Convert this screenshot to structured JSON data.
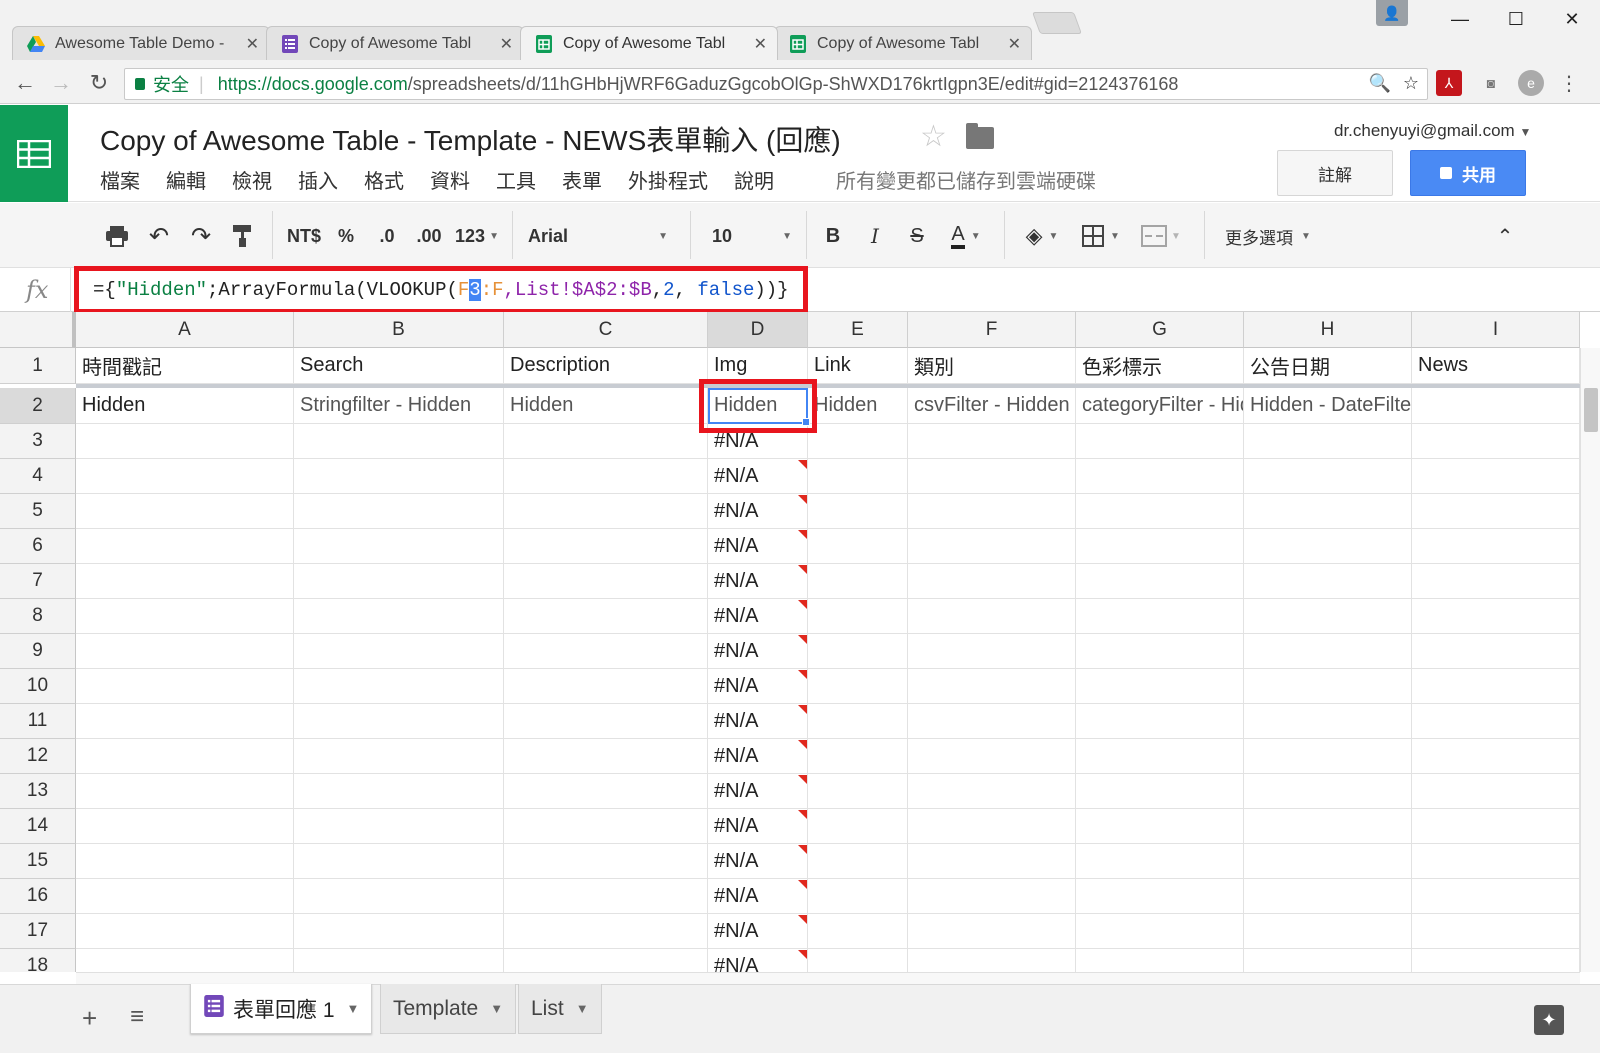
{
  "browser": {
    "tabs": [
      {
        "title": "Awesome Table Demo -",
        "icon": "drive-icon"
      },
      {
        "title": "Copy of Awesome Tabl",
        "icon": "forms-icon"
      },
      {
        "title": "Copy of Awesome Tabl",
        "icon": "sheets-icon",
        "active": true
      },
      {
        "title": "Copy of Awesome Tabl",
        "icon": "sheets-icon"
      }
    ],
    "secure_label": "安全",
    "url_host": "https://docs.google.com",
    "url_path": "/spreadsheets/d/11hGHbHjWRF6GaduzGgcobOlGp-ShWXD176krtIgpn3E/edit#gid=2124376168"
  },
  "app": {
    "title": "Copy of Awesome Table - Template - NEWS表單輸入 (回應)",
    "menu": [
      "檔案",
      "編輯",
      "檢視",
      "插入",
      "格式",
      "資料",
      "工具",
      "表單",
      "外掛程式",
      "說明"
    ],
    "save_status": "所有變更都已儲存到雲端硬碟",
    "account": "dr.chenyuyi@gmail.com",
    "comment_label": "註解",
    "share_label": "共用"
  },
  "toolbar": {
    "currency": "NT$",
    "percent": "%",
    "dec_decrease": ".0",
    "dec_increase": ".00",
    "more_formats": "123",
    "font": "Arial",
    "font_size": "10",
    "bold": "B",
    "italic": "I",
    "strike": "S",
    "text_color": "A",
    "more_label": "更多選項"
  },
  "formula": {
    "fx": "fx",
    "p1": "={",
    "p2": "\"Hidden\"",
    "p3": ";ArrayFormula(VLOOKUP(",
    "p4a": "F",
    "p4b": "3",
    "p4c": ":F",
    "p5": ",List!$A$2:$B",
    "p6": ",",
    "p7": "2",
    "p8": ", ",
    "p9": "false",
    "p10": "))}"
  },
  "grid": {
    "columns": [
      "A",
      "B",
      "C",
      "D",
      "E",
      "F",
      "G",
      "H",
      "I"
    ],
    "selected_column": "D",
    "rows": [
      "1",
      "2",
      "3",
      "4",
      "5",
      "6",
      "7",
      "8",
      "9",
      "10",
      "11",
      "12",
      "13",
      "14",
      "15",
      "16",
      "17",
      "18"
    ],
    "selected_row": "2",
    "header_row": [
      "時間戳記",
      "Search",
      "Description",
      "Img",
      "Link",
      "類別",
      "色彩標示",
      "公告日期",
      "News"
    ],
    "row2": [
      "Hidden",
      "Stringfilter - Hidden",
      "Hidden",
      "Hidden",
      "Hidden",
      "csvFilter - Hidden",
      "categoryFilter - Hidden",
      "Hidden - DateFilter",
      ""
    ],
    "error_value": "#N/A",
    "active_cell": "D2"
  },
  "sheets": {
    "tabs": [
      {
        "name": "表單回應 1",
        "active": true
      },
      {
        "name": "Template"
      },
      {
        "name": "List"
      }
    ]
  },
  "colors": {
    "accent": "#4285f4",
    "sheets_green": "#0f9d58",
    "highlight_red": "#e8151e",
    "share_blue": "#4a8af4"
  }
}
